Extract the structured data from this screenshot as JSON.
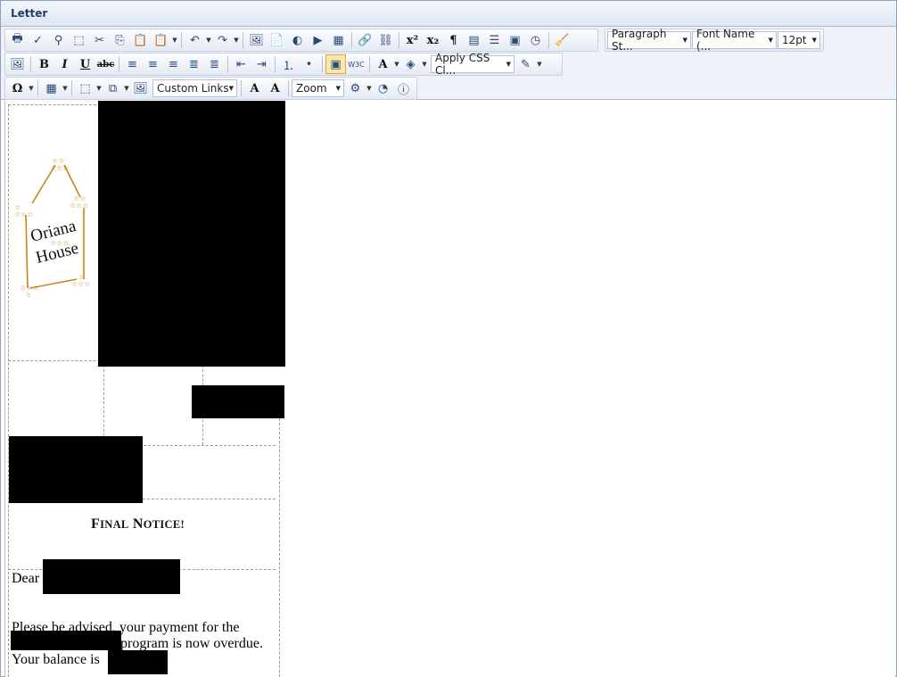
{
  "window": {
    "title": "Letter"
  },
  "toolbar": {
    "paragraph_style": "Paragraph St...",
    "font_name": "Font Name (...",
    "font_size": "12pt",
    "apply_css": "Apply CSS Cl...",
    "custom_links": "Custom Links",
    "zoom": "Zoom",
    "bold": "B",
    "italic": "I",
    "underline": "U",
    "strike": "abc"
  },
  "letter": {
    "logo_line1": "Oriana",
    "logo_line2": "House",
    "notice_first": "F",
    "notice_inal": "INAL",
    "notice_n": "N",
    "notice_otice": "OTICE!",
    "greeting": "Dear",
    "para_line1": "Please be advised, your payment for the",
    "para_line2": "program is now overdue.",
    "para_line3": "Your balance is"
  },
  "colors": {
    "titlebar": "#dde6f2",
    "toolbar": "#eef2f8",
    "logo_gold": "#c8861c"
  }
}
